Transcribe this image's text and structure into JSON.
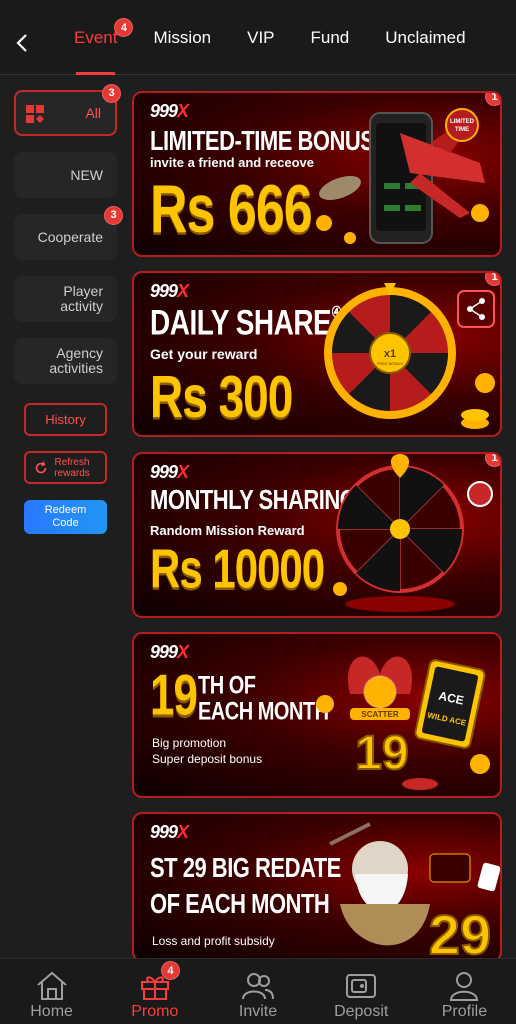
{
  "tabs": [
    {
      "label": "Event",
      "badge": "4",
      "active": true
    },
    {
      "label": "Mission"
    },
    {
      "label": "VIP"
    },
    {
      "label": "Fund"
    },
    {
      "label": "Unclaimed"
    }
  ],
  "sidebar": {
    "items": [
      {
        "label": "All",
        "badge": "3"
      },
      {
        "label": "NEW"
      },
      {
        "label": "Cooperate",
        "badge": "3"
      },
      {
        "label": "Player activity"
      },
      {
        "label": "Agency activities"
      }
    ],
    "history_label": "History",
    "refresh_label": "Refresh rewards",
    "redeem_label": "Redeem Code"
  },
  "banners": [
    {
      "logo_main": "999",
      "logo_accent": "X",
      "title": "LIMITED-TIME BONUS",
      "subtitle": "invite a friend and receove",
      "amount": "Rs 666",
      "badge": "1",
      "tag": "LIMITED TIME"
    },
    {
      "logo_main": "999",
      "logo_accent": "X",
      "title": "DAILY SHARE",
      "title_mark": "④",
      "subtitle": "Get your reward",
      "amount": "Rs 300",
      "badge": "1",
      "wheel_center": "x1",
      "wheel_center_sub": "FREE BONUS"
    },
    {
      "logo_main": "999",
      "logo_accent": "X",
      "title": "MONTHLY SHARING",
      "subtitle": "Random Mission Reward",
      "amount": "Rs 10000",
      "badge": "1"
    },
    {
      "logo_main": "999",
      "logo_accent": "X",
      "title_num": "19",
      "title_line1": "TH OF",
      "title_line2": "EACH MONTH",
      "line1": "Big promotion",
      "line2": "Super deposit bonus",
      "art_num": "19",
      "scatter": "SCATTER",
      "card": "ACE",
      "card2": "WILD ACE"
    },
    {
      "logo_main": "999",
      "logo_accent": "X",
      "title_line1": "ST 29 BIG REDATE",
      "title_line2": "OF EACH MONTH",
      "line1": "Loss and profit subsidy",
      "art_num": "29"
    }
  ],
  "bottom_nav": [
    {
      "label": "Home",
      "icon": "home-icon"
    },
    {
      "label": "Promo",
      "icon": "gift-icon",
      "badge": "4",
      "active": true
    },
    {
      "label": "Invite",
      "icon": "invite-icon"
    },
    {
      "label": "Deposit",
      "icon": "wallet-icon"
    },
    {
      "label": "Profile",
      "icon": "profile-icon"
    }
  ],
  "colors": {
    "accent": "#ff3b3b",
    "background": "#1e1e1e",
    "gold": "#ffc400",
    "blue": "#2196f3"
  }
}
